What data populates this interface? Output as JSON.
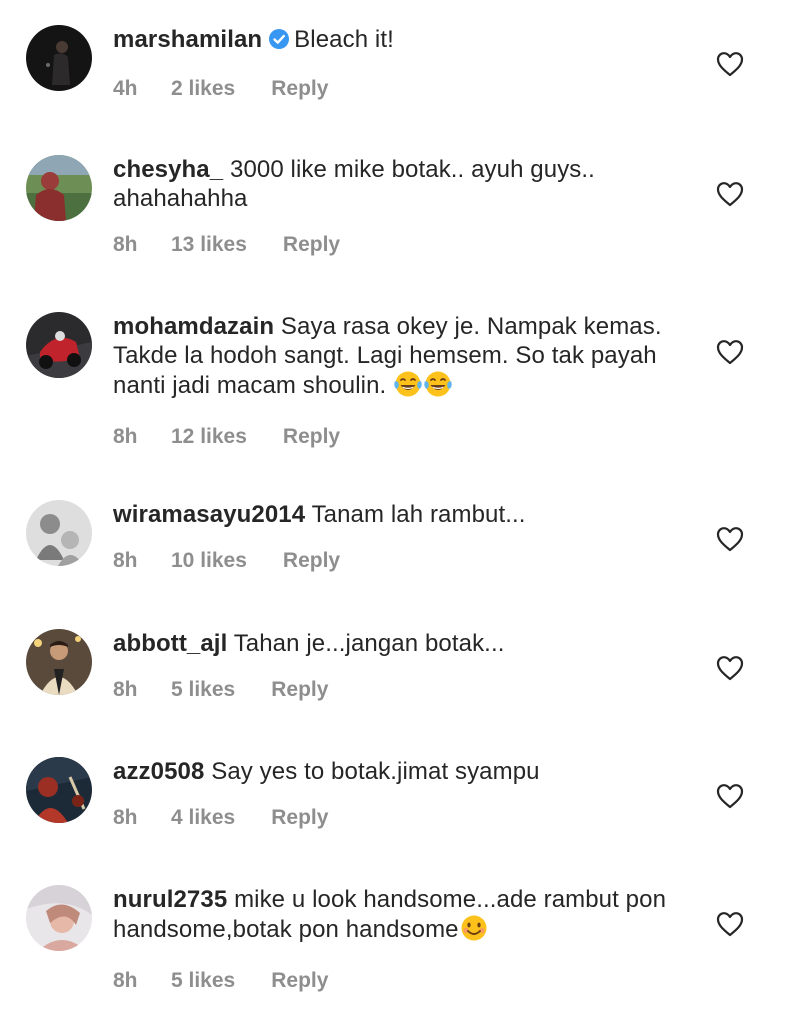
{
  "comments": [
    {
      "username": "marshamilan",
      "verified": true,
      "text": "Bleach it!",
      "time": "4h",
      "likes": "2 likes",
      "reply": "Reply"
    },
    {
      "username": "chesyha_",
      "verified": false,
      "text": "3000 like mike botak.. ayuh guys.. ahahahahha",
      "time": "8h",
      "likes": "13 likes",
      "reply": "Reply"
    },
    {
      "username": "mohamdazain",
      "verified": false,
      "text": "Saya rasa okey je. Nampak kemas. Takde la hodoh sangt. Lagi hemsem. So tak payah nanti jadi macam shoulin.",
      "time": "8h",
      "likes": "12 likes",
      "reply": "Reply",
      "emojis": [
        "laughing-tears-emoji",
        "laughing-tears-emoji"
      ]
    },
    {
      "username": "wiramasayu2014",
      "verified": false,
      "text": "Tanam lah rambut...",
      "time": "8h",
      "likes": "10 likes",
      "reply": "Reply"
    },
    {
      "username": "abbott_ajl",
      "verified": false,
      "text": "Tahan je...jangan botak...",
      "time": "8h",
      "likes": "5 likes",
      "reply": "Reply"
    },
    {
      "username": "azz0508",
      "verified": false,
      "text": "Say yes to botak.jimat syampu",
      "time": "8h",
      "likes": "4 likes",
      "reply": "Reply"
    },
    {
      "username": "nurul2735",
      "verified": false,
      "text": "mike u look handsome...ade rambut pon handsome,botak pon handsome",
      "time": "8h",
      "likes": "5 likes",
      "reply": "Reply",
      "emojis": [
        "smiling-emoji"
      ]
    }
  ],
  "colors": {
    "text": "#262626",
    "meta": "#8e8e8e",
    "verified": "#3897f0",
    "heart": "#262626"
  }
}
